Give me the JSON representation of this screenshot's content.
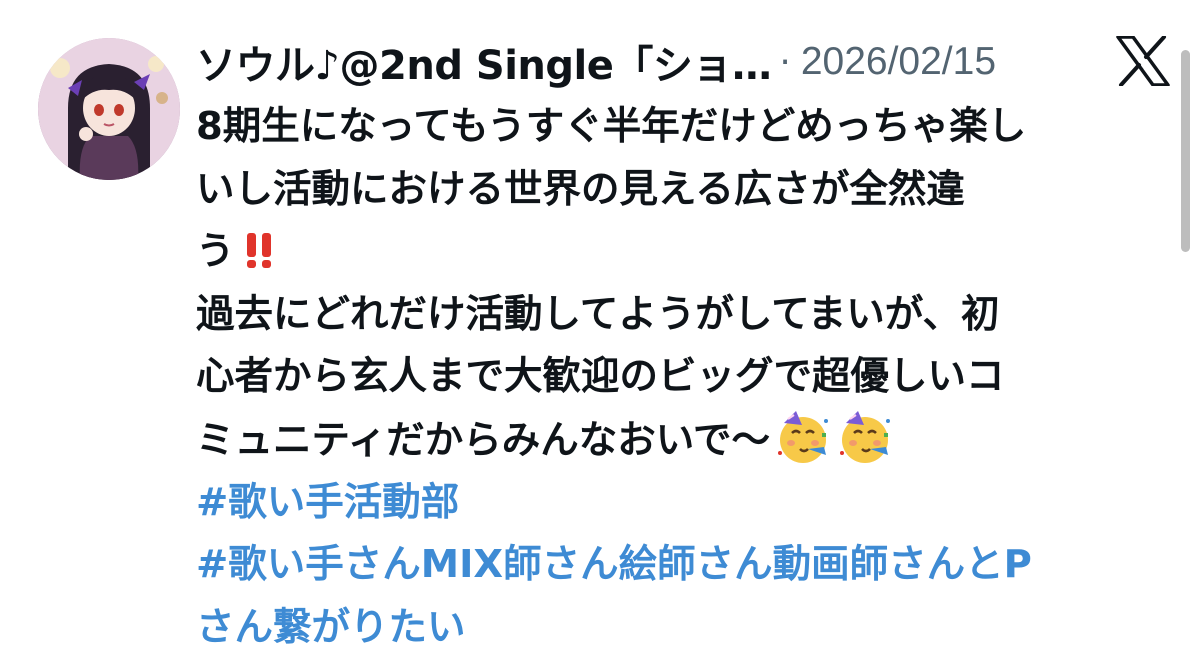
{
  "tweet": {
    "display_name": "ソウル♪@2nd Single「ショ…",
    "separator": "·",
    "date": "2026/02/15",
    "lines": [
      "8期生になってもうすぐ半年だけどめっちゃ楽し",
      "いし活動における世界の見える広さが全然違",
      "う",
      "過去にどれだけ活動してようがしてまいが、初",
      "心者から玄人まで大歓迎のビッグで超優しいコ",
      "ミュニティだからみんなおいで〜"
    ],
    "hashtags": [
      "#歌い手活動部",
      "#歌い手さんMIX師さん絵師さん動画師さんとP",
      "さん繋がりたい"
    ]
  },
  "icons": {
    "brand": "x-logo-icon",
    "exclamation": "double-exclamation-icon",
    "party": "partying-face-icon"
  },
  "colors": {
    "text": "#0f1419",
    "secondary": "#536471",
    "hashtag": "#3e8bd4",
    "exclamation": "#e0342b"
  }
}
